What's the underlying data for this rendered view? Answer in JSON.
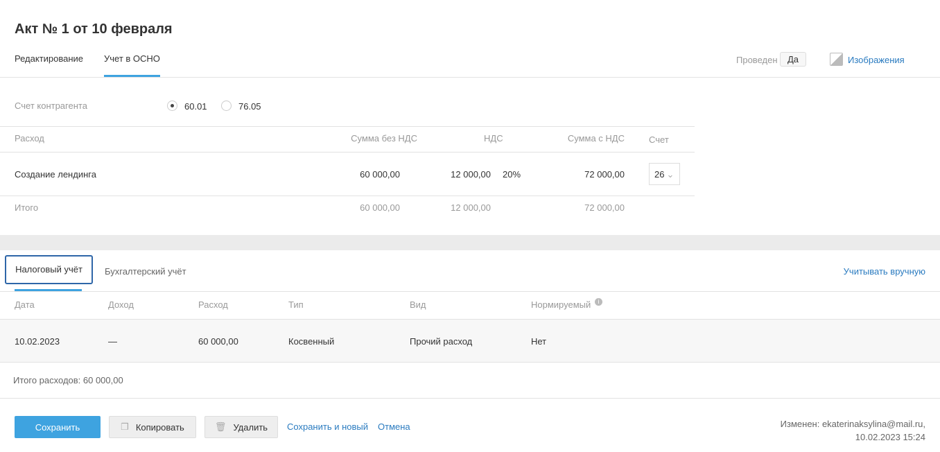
{
  "title": "Акт № 1 от 10 февраля",
  "tabs": [
    "Редактирование",
    "Учет в ОСНО"
  ],
  "posted_label": "Проведен",
  "posted_value": "Да",
  "images_label": "Изображения",
  "counterparty": {
    "label": "Счет контрагента",
    "options": [
      "60.01",
      "76.05"
    ],
    "selected": "60.01"
  },
  "expense_table": {
    "headers": [
      "Расход",
      "Сумма без НДС",
      "НДС",
      "Сумма с НДС",
      "Счет"
    ],
    "row": {
      "name": "Создание лендинга",
      "sum": "60 000,00",
      "vat": "12 000,00",
      "rate": "20%",
      "total": "72 000,00",
      "account": "26"
    },
    "totals": {
      "label": "Итого",
      "sum": "60 000,00",
      "vat": "12 000,00",
      "total": "72 000,00"
    }
  },
  "subtabs": [
    "Налоговый учёт",
    "Бухгалтерский учёт"
  ],
  "manual_link": "Учитывать вручную",
  "tax_table": {
    "headers": [
      "Дата",
      "Доход",
      "Расход",
      "Тип",
      "Вид",
      "Нормируемый"
    ],
    "row": [
      "10.02.2023",
      "—",
      "60 000,00",
      "Косвенный",
      "Прочий расход",
      "Нет"
    ]
  },
  "total_expenses": "Итого расходов: 60 000,00",
  "footer": {
    "save": "Сохранить",
    "copy": "Копировать",
    "delete": "Удалить",
    "save_new": "Сохранить и новый",
    "cancel": "Отмена",
    "changed_by": "Изменен: ekaterinaksylina@mail.ru,",
    "changed_at": "10.02.2023 15:24"
  }
}
